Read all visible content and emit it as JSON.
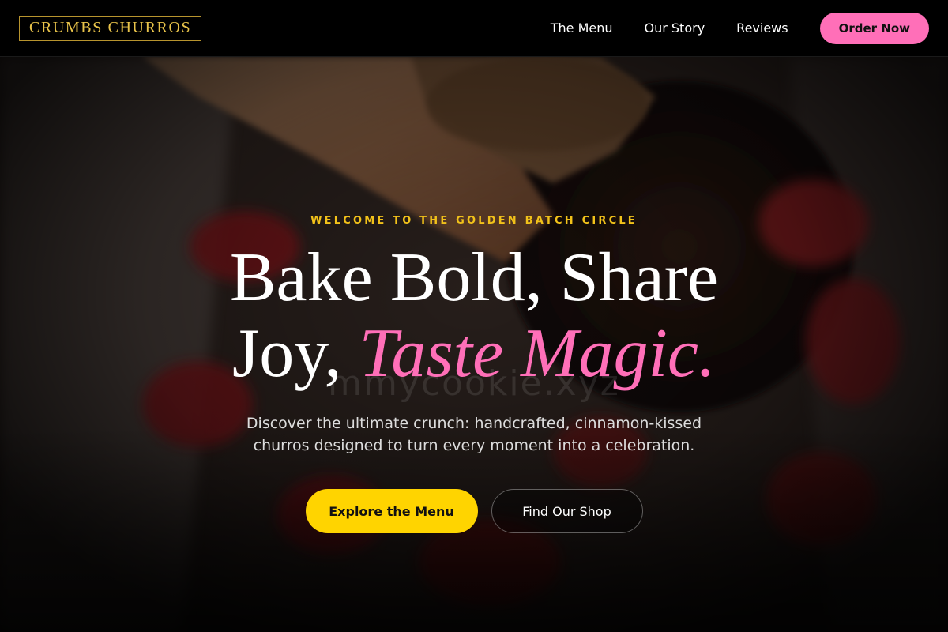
{
  "brand": {
    "name": "CRUMBS CHURROS"
  },
  "nav": {
    "links": [
      "The Menu",
      "Our Story",
      "Reviews"
    ],
    "cta": "Order Now"
  },
  "hero": {
    "eyebrow": "WELCOME TO THE GOLDEN BATCH CIRCLE",
    "headline_line1": "Bake Bold, Share",
    "headline_line2_plain": "Joy, ",
    "headline_line2_accent": "Taste Magic.",
    "watermark": "mmycookie.xyz",
    "subtext_line1": "Discover the ultimate crunch: handcrafted, cinnamon-kissed",
    "subtext_line2": "churros designed to turn every moment into a celebration.",
    "primary_cta": "Explore the Menu",
    "secondary_cta": "Find Our Shop",
    "background_image": "churro-with-chocolate-and-strawberries"
  },
  "colors": {
    "gold": "#e8c34a",
    "pink": "#ff6fb8",
    "yellow": "#ffd400",
    "eyebrow": "#f2c21a"
  }
}
